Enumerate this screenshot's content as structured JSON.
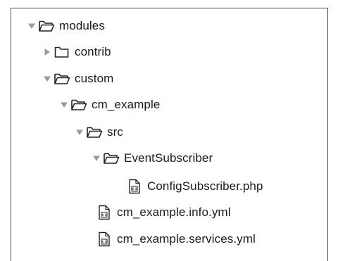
{
  "tree": {
    "items": [
      {
        "label": "modules",
        "type": "folder",
        "state": "expanded",
        "depth": 0,
        "icon": "folder-open-icon"
      },
      {
        "label": "contrib",
        "type": "folder",
        "state": "collapsed",
        "depth": 1,
        "icon": "folder-icon"
      },
      {
        "label": "custom",
        "type": "folder",
        "state": "expanded",
        "depth": 1,
        "icon": "folder-open-icon"
      },
      {
        "label": "cm_example",
        "type": "folder",
        "state": "expanded",
        "depth": 2,
        "icon": "folder-open-icon"
      },
      {
        "label": "src",
        "type": "folder",
        "state": "expanded",
        "depth": 3,
        "icon": "folder-open-icon"
      },
      {
        "label": "EventSubscriber",
        "type": "folder",
        "state": "expanded",
        "depth": 4,
        "icon": "folder-open-icon"
      },
      {
        "label": "ConfigSubscriber.php",
        "type": "file",
        "depth": 5,
        "icon": "code-file-icon"
      },
      {
        "label": "cm_example.info.yml",
        "type": "file",
        "depth": 3,
        "icon": "code-file-icon"
      },
      {
        "label": "cm_example.services.yml",
        "type": "file",
        "depth": 3,
        "icon": "code-file-icon"
      }
    ]
  },
  "colors": {
    "disclosure": "#9a9a9a",
    "icon_stroke": "#222222",
    "text": "#1a1a1a",
    "border": "#4a4a4a"
  }
}
